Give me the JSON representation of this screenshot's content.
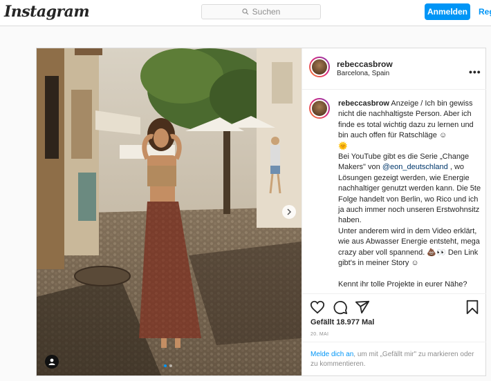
{
  "header": {
    "logo": "Instagram",
    "search_placeholder": "Suchen",
    "login_label": "Anmelden",
    "register_label": "Reg"
  },
  "post": {
    "username": "rebeccasbrow",
    "location": "Barcelona, Spain",
    "more_label": "•••",
    "caption": {
      "username": "rebeccasbrow",
      "part1": " Anzeige / Ich bin gewiss nicht die nachhaltigste Person. Aber ich finde es total wichtig dazu zu lernen und bin auch offen für Ratschläge ☺\n🌞\nBei YouTube gibt es die Serie „Change Makers\" von ",
      "mention": "@eon_deutschland",
      "part2": " , wo Lösungen gezeigt werden, wie Energie nachhaltiger genutzt werden kann. Die 5te Folge handelt von Berlin, wo Rico und ich ja auch immer noch unseren Erstwohnsitz haben.\nUnter anderem wird in dem Video erklärt, wie aus Abwasser Energie entsteht, mega crazy aber voll spannend. 💩👀 Den Link gibt's in meiner Story ☺\n\nKennt ihr tolle Projekte in eurer Nähe?"
    },
    "likes": "Gefällt 18.977 Mal",
    "date": "20. MAI",
    "footer": {
      "link": "Melde dich an",
      "rest": ", um mit „Gefällt mir\" zu markieren oder zu kommentieren."
    },
    "carousel": {
      "slides": 2,
      "active": 1
    }
  },
  "icons": [
    "search-icon",
    "heart-icon",
    "comment-icon",
    "share-icon",
    "bookmark-icon",
    "more-icon",
    "next-arrow-icon",
    "user-tag-icon"
  ],
  "colors": {
    "accent": "#0095f6",
    "border": "#dbdbdb",
    "text": "#262626",
    "muted": "#8e8e8e"
  }
}
